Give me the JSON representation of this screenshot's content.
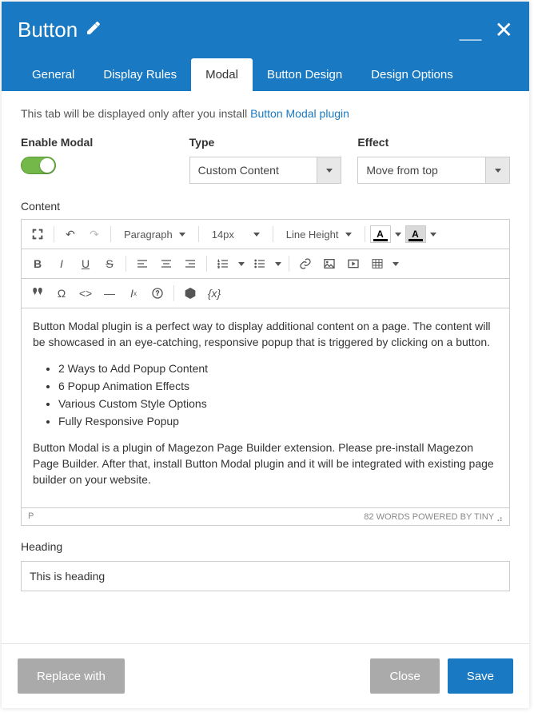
{
  "header": {
    "title": "Button"
  },
  "tabs": [
    {
      "label": "General"
    },
    {
      "label": "Display Rules"
    },
    {
      "label": "Modal",
      "active": true
    },
    {
      "label": "Button Design"
    },
    {
      "label": "Design Options"
    }
  ],
  "notice": {
    "text": "This tab will be displayed only after you install ",
    "link_text": "Button Modal plugin"
  },
  "fields": {
    "enable_modal": {
      "label": "Enable Modal",
      "value": true
    },
    "type": {
      "label": "Type",
      "value": "Custom Content"
    },
    "effect": {
      "label": "Effect",
      "value": "Move from top"
    },
    "content_label": "Content",
    "heading": {
      "label": "Heading",
      "value": "This is heading"
    }
  },
  "editor": {
    "toolbar": {
      "format": "Paragraph",
      "fontsize": "14px",
      "lineheight": "Line Height"
    },
    "body": {
      "p1": "Button Modal plugin is a perfect way to display additional content on a page. The content will be showcased in an eye-catching, responsive popup that is triggered by clicking on a button.",
      "li1": "2 Ways to Add Popup Content",
      "li2": "6 Popup Animation Effects",
      "li3": "Various Custom Style Options",
      "li4": "Fully Responsive Popup",
      "p2": "Button Modal is a plugin of Magezon Page Builder extension. Please pre-install Magezon Page Builder. After that, install Button Modal plugin and it will be integrated with existing page builder on your website."
    },
    "status": {
      "path": "P",
      "words": "82 WORDS POWERED BY TINY"
    }
  },
  "footer": {
    "replace": "Replace with",
    "close": "Close",
    "save": "Save"
  }
}
